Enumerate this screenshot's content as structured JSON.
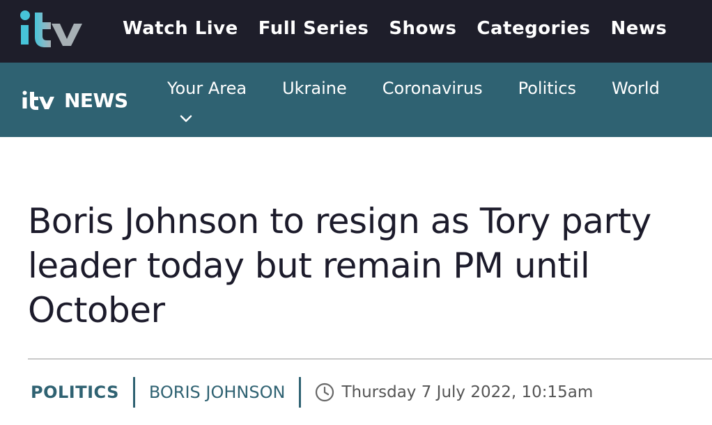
{
  "top_nav": {
    "logo_icon": "itv-logo",
    "items": [
      "Watch Live",
      "Full Series",
      "Shows",
      "Categories",
      "News"
    ]
  },
  "news_nav": {
    "logo_text": "NEWS",
    "items": [
      "Your Area",
      "Ukraine",
      "Coronavirus",
      "Politics",
      "World"
    ]
  },
  "article": {
    "headline": "Boris Johnson to resign as Tory party leader today but remain PM until October",
    "tags": [
      "POLITICS",
      "BORIS JOHNSON"
    ],
    "date": "Thursday 7 July 2022, 10:15am"
  },
  "colors": {
    "top_bar": "#1e1e2a",
    "news_bar": "#2f6272",
    "accent": "#2f6272",
    "logo_gradient_start": "#47c4d9",
    "logo_gradient_end": "#a7b0b5"
  }
}
